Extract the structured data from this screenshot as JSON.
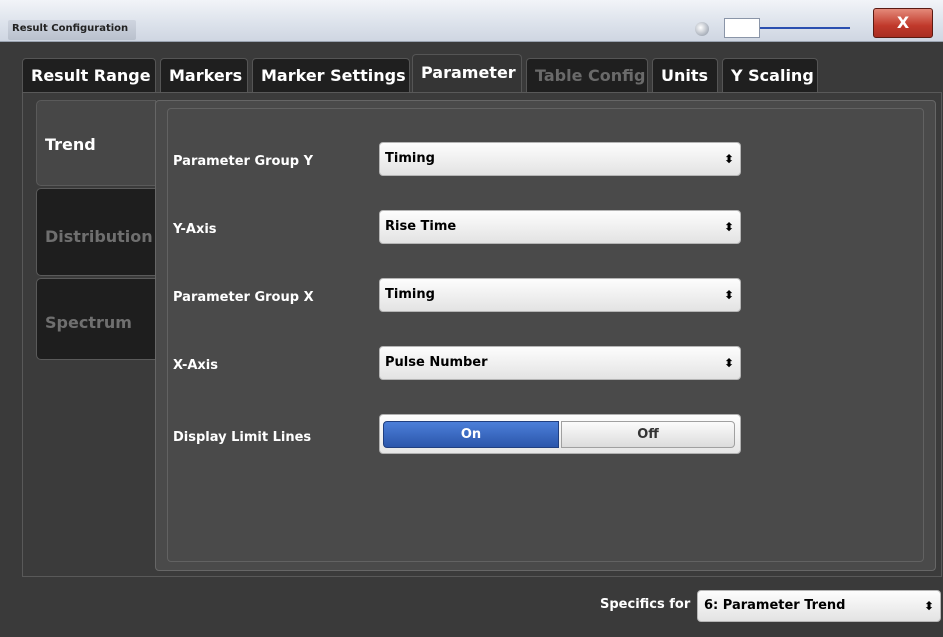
{
  "window": {
    "title": "Result Configuration",
    "close_label": "X"
  },
  "tabs": [
    {
      "label": "Result Range"
    },
    {
      "label": "Markers"
    },
    {
      "label": "Marker Settings"
    },
    {
      "label": "Parameter"
    },
    {
      "label": "Table Config"
    },
    {
      "label": "Units"
    },
    {
      "label": "Y Scaling"
    }
  ],
  "side_tabs": [
    {
      "label": "Trend"
    },
    {
      "label": "Distribution"
    },
    {
      "label": "Spectrum"
    }
  ],
  "fields": {
    "param_group_y": {
      "label": "Parameter Group Y",
      "value": "Timing"
    },
    "y_axis": {
      "label": "Y-Axis",
      "value": "Rise Time"
    },
    "param_group_x": {
      "label": "Parameter Group X",
      "value": "Timing"
    },
    "x_axis": {
      "label": "X-Axis",
      "value": "Pulse Number"
    },
    "limit_lines": {
      "label": "Display Limit Lines",
      "on_label": "On",
      "off_label": "Off"
    }
  },
  "footer": {
    "specifics_label": "Specifics for",
    "specifics_value": "6: Parameter Trend"
  },
  "icons": {
    "select_arrows": "⬍"
  }
}
